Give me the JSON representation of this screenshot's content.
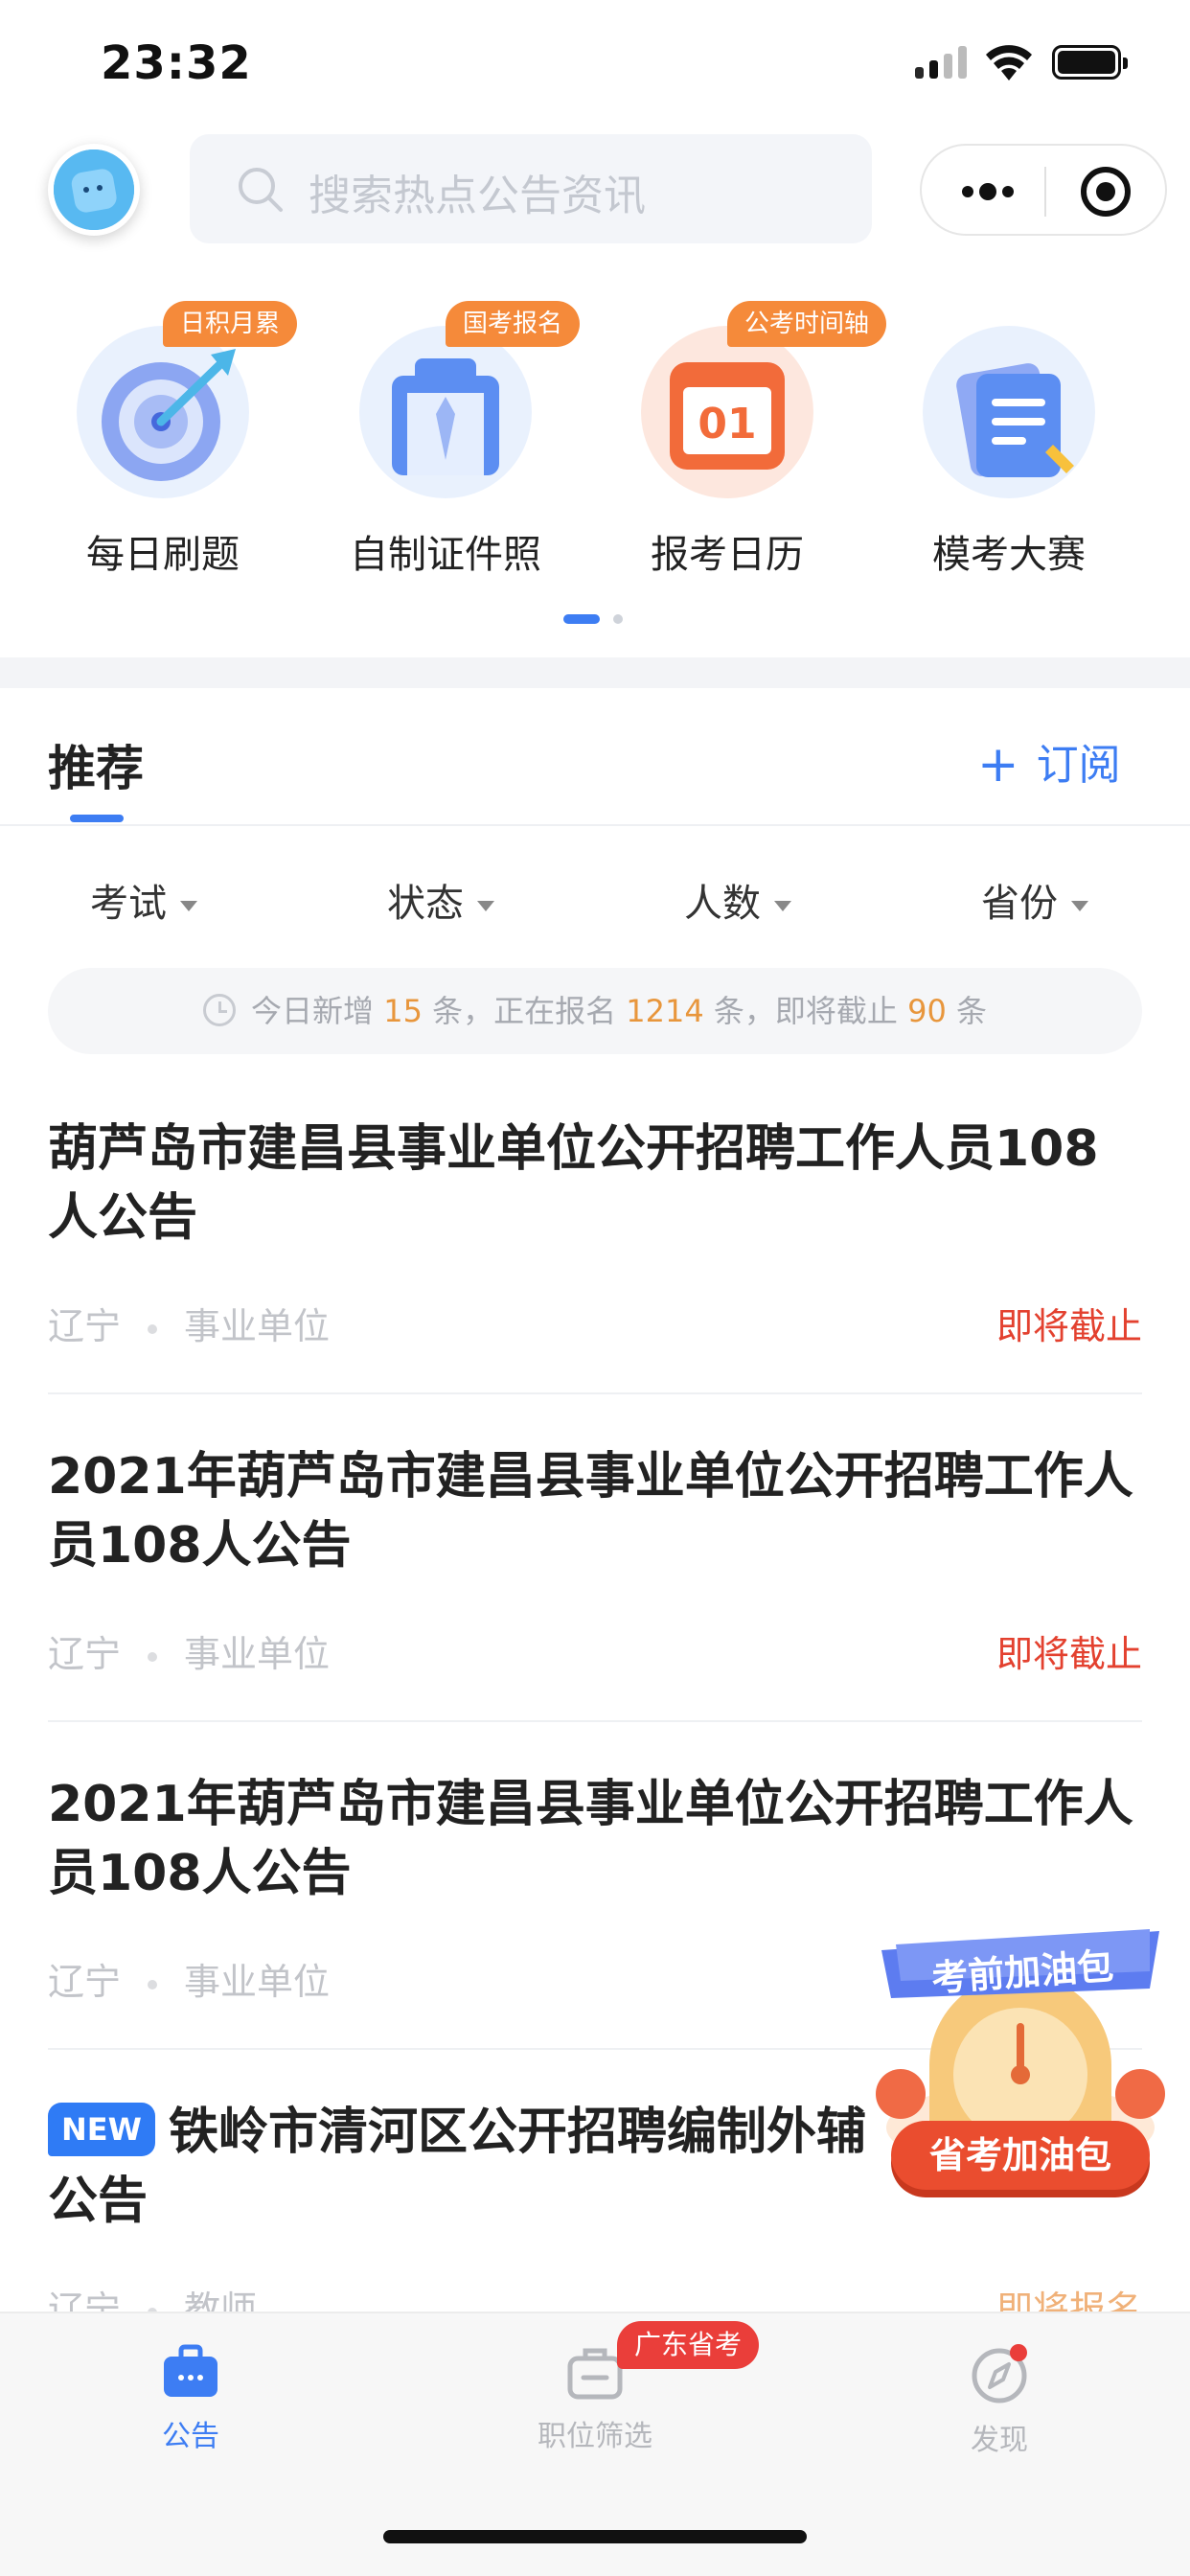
{
  "status_bar": {
    "time": "23:32"
  },
  "search": {
    "placeholder": "搜索热点公告资讯"
  },
  "categories": [
    {
      "label": "每日刷题",
      "tag": "日积月累",
      "icon": "target-icon"
    },
    {
      "label": "自制证件照",
      "tag": "国考报名",
      "icon": "id-photo-icon"
    },
    {
      "label": "报考日历",
      "tag": "公考时间轴",
      "icon": "calendar-icon",
      "calendar_day": "01"
    },
    {
      "label": "模考大赛",
      "tag": "",
      "icon": "document-pen-icon"
    }
  ],
  "recommend": {
    "title": "推荐",
    "subscribe": "订阅"
  },
  "filters": [
    "考试",
    "状态",
    "人数",
    "省份"
  ],
  "info": {
    "prefix": "今日新增",
    "new_count": "15",
    "unit1": "条，正在报名",
    "enrolling": "1214",
    "unit2": "条，即将截止",
    "closing": "90",
    "unit3": "条"
  },
  "articles": [
    {
      "title": "葫芦岛市建昌县事业单位公开招聘工作人员108人公告",
      "region": "辽宁",
      "category": "事业单位",
      "status": "即将截止"
    },
    {
      "title": "2021年葫芦岛市建昌县事业单位公开招聘工作人员108人公告",
      "region": "辽宁",
      "category": "事业单位",
      "status": "即将截止"
    },
    {
      "title": "2021年葫芦岛市建昌县事业单位公开招聘工作人员108人公告",
      "region": "辽宁",
      "category": "事业单位",
      "status": ""
    },
    {
      "badge": "NEW",
      "title": "铁岭市清河区公开招聘编制外辅",
      "title2": "公告",
      "region": "辽宁",
      "category": "教师",
      "status": "即将报名"
    }
  ],
  "promo": {
    "top": "考前加油包",
    "button": "省考加油包"
  },
  "tabbar": [
    {
      "label": "公告",
      "icon": "briefcase-icon",
      "active": true
    },
    {
      "label": "职位筛选",
      "icon": "suitcase-icon",
      "badge": "广东省考"
    },
    {
      "label": "发现",
      "icon": "compass-icon"
    }
  ],
  "colors": {
    "accent": "#3d7df3",
    "orange": "#f58a3a",
    "red": "#e3412f"
  }
}
